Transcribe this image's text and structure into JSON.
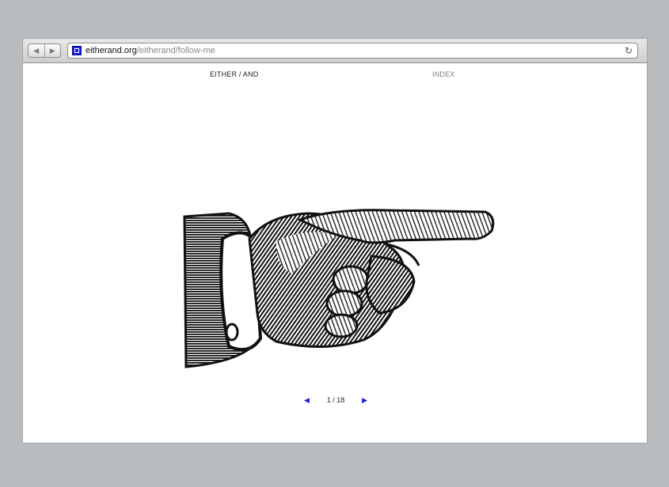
{
  "browser": {
    "back_icon": "◀",
    "forward_icon": "▶",
    "url_domain": "eitherand.org",
    "url_path": "/eitherand/follow-me",
    "reload_icon": "↻"
  },
  "site_nav": {
    "left_label": "EITHER / AND",
    "right_label": "INDEX"
  },
  "artwork": {
    "description_icon": "pointing-hand-illustration"
  },
  "pager": {
    "prev_icon": "◀",
    "current": "1",
    "separator": "/",
    "total": "18",
    "next_icon": "▶"
  },
  "colors": {
    "background": "#b9bcbe",
    "link_blue": "#1a1ad8",
    "favicon_blue": "#1a1adf"
  }
}
